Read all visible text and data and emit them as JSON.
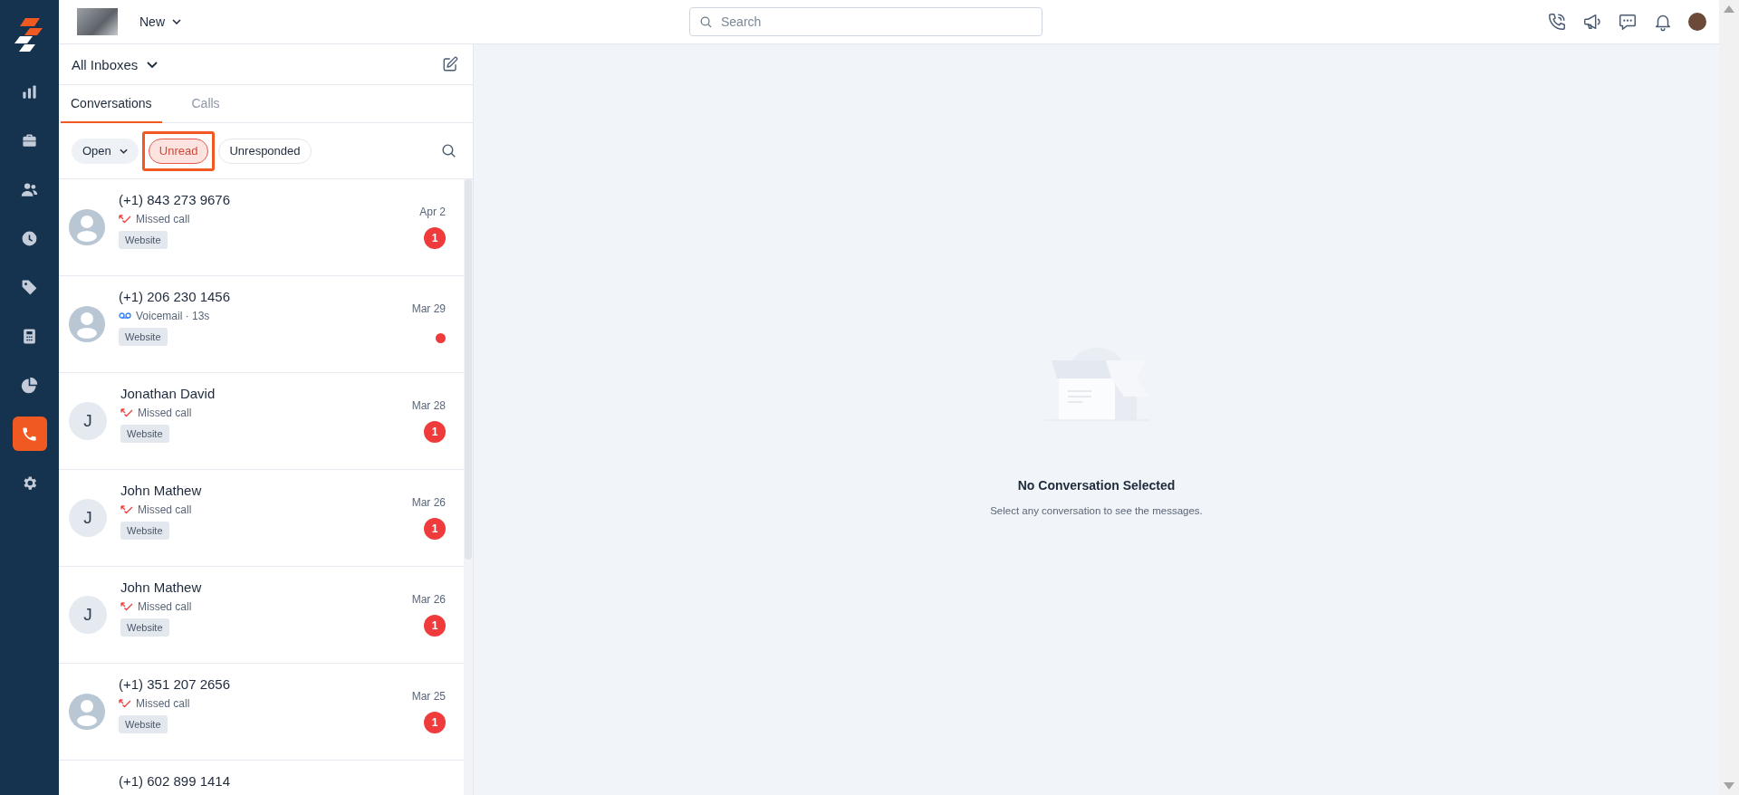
{
  "sidebar": {
    "items": [
      {
        "kind": "chart",
        "selected": false
      },
      {
        "kind": "briefcase",
        "selected": false
      },
      {
        "kind": "people",
        "selected": false
      },
      {
        "kind": "clock",
        "selected": false
      },
      {
        "kind": "tag",
        "selected": false
      },
      {
        "kind": "calculator",
        "selected": false
      },
      {
        "kind": "pie",
        "selected": false
      },
      {
        "kind": "phone",
        "selected": true
      },
      {
        "kind": "gear",
        "selected": false
      }
    ]
  },
  "top_bar": {
    "new_menu": "New",
    "search": {
      "placeholder": "Search"
    },
    "actions": [
      {
        "kind": "phone"
      },
      {
        "kind": "megaphone"
      },
      {
        "kind": "chat"
      },
      {
        "kind": "bell"
      }
    ]
  },
  "inbox_panel": {
    "inbox_selector": "All Inboxes",
    "tabs": [
      {
        "label": "Conversations",
        "selected": true
      },
      {
        "label": "Calls",
        "selected": false
      }
    ],
    "filters": [
      {
        "label": "Open",
        "kind": "dropdown",
        "selected": false,
        "highlighted": false
      },
      {
        "label": "Unread",
        "kind": "chip",
        "selected": true,
        "highlighted": true
      },
      {
        "label": "Unresponded",
        "kind": "chip",
        "selected": false,
        "highlighted": false
      }
    ],
    "conversations": [
      {
        "name": "(+1) 843 273 9676",
        "avatar": {
          "kind": "silhouette"
        },
        "call": {
          "kind": "missed",
          "text": "Missed call"
        },
        "tag": "Website",
        "date": "Apr 2",
        "indicator": {
          "kind": "count",
          "text": "1"
        }
      },
      {
        "name": "(+1) 206 230 1456",
        "avatar": {
          "kind": "silhouette"
        },
        "call": {
          "kind": "voicemail",
          "text": "Voicemail · 13s"
        },
        "tag": "Website",
        "date": "Mar 29",
        "indicator": {
          "kind": "dot"
        }
      },
      {
        "name": "Jonathan David",
        "avatar": {
          "kind": "initial",
          "text": "J"
        },
        "call": {
          "kind": "missed",
          "text": "Missed call"
        },
        "tag": "Website",
        "date": "Mar 28",
        "indicator": {
          "kind": "count",
          "text": "1"
        }
      },
      {
        "name": "John Mathew",
        "avatar": {
          "kind": "initial",
          "text": "J"
        },
        "call": {
          "kind": "missed",
          "text": "Missed call"
        },
        "tag": "Website",
        "date": "Mar 26",
        "indicator": {
          "kind": "count",
          "text": "1"
        }
      },
      {
        "name": "John Mathew",
        "avatar": {
          "kind": "initial",
          "text": "J"
        },
        "call": {
          "kind": "missed",
          "text": "Missed call"
        },
        "tag": "Website",
        "date": "Mar 26",
        "indicator": {
          "kind": "count",
          "text": "1"
        }
      },
      {
        "name": "(+1) 351 207 2656",
        "avatar": {
          "kind": "silhouette"
        },
        "call": {
          "kind": "missed",
          "text": "Missed call"
        },
        "tag": "Website",
        "date": "Mar 25",
        "indicator": {
          "kind": "count",
          "text": "1"
        }
      },
      {
        "name": "(+1) 602 899 1414"
      }
    ]
  },
  "empty_state": {
    "title": "No Conversation Selected",
    "message": "Select any conversation to see the messages."
  }
}
